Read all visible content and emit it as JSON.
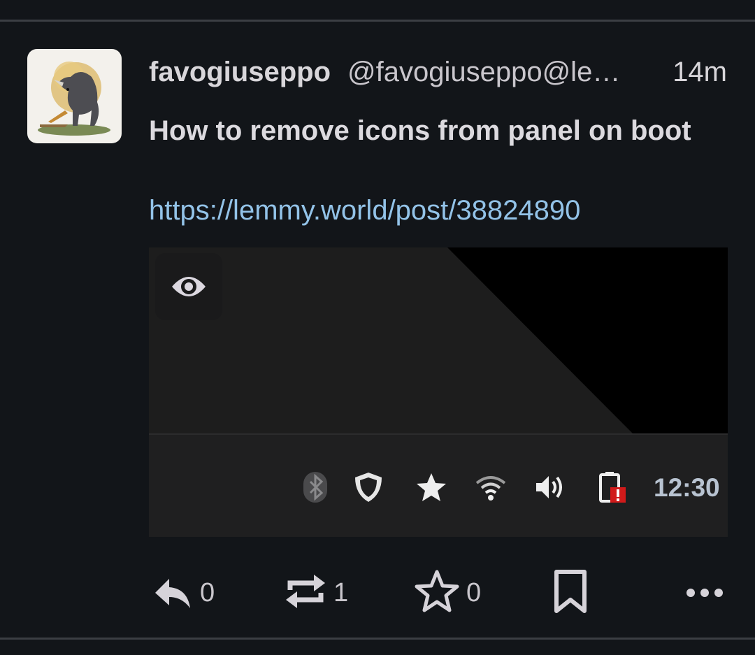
{
  "post": {
    "display_name": "favogiuseppo",
    "handle": "@favogiuseppo@le…",
    "time": "14m",
    "title": "How to remove icons from panel on boot",
    "link": "https://lemmy.world/post/38824890"
  },
  "media": {
    "tray_icons": [
      "bluetooth-icon",
      "shield-icon",
      "star-icon",
      "wifi-icon",
      "volume-icon",
      "battery-alert-icon"
    ],
    "clock": "12:30"
  },
  "actions": {
    "reply_count": "0",
    "boost_count": "1",
    "favourite_count": "0"
  },
  "colors": {
    "background": "#121519",
    "link": "#93c3e8",
    "text": "#d8d6da",
    "divider": "#3b3e43"
  }
}
